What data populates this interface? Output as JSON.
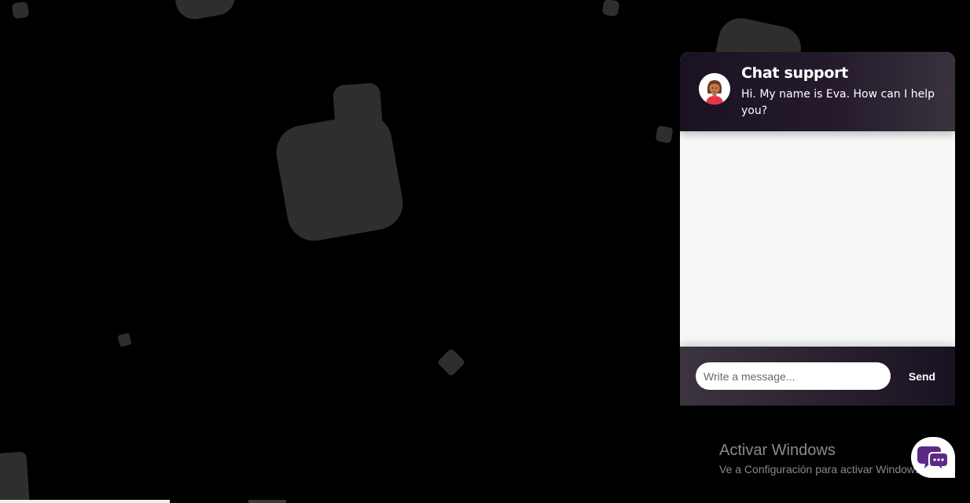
{
  "chat": {
    "title": "Chat support",
    "greeting": "Hi. My name is Eva. How can I help you?",
    "avatar_icon": "female-support-agent-avatar",
    "input_placeholder": "Write a message...",
    "input_value": "",
    "send_label": "Send",
    "launcher_icon": "chat-bubbles-icon"
  },
  "watermark": {
    "title": "Activar Windows",
    "subtitle": "Ve a Configuración para activar Windows."
  },
  "colors": {
    "background": "#000000",
    "floating_shape": "#2e2e2e",
    "header_dark": "#1a1222",
    "header_light": "#3a323d",
    "body": "#f8f8f8",
    "launcher_icon": "#5b2a86"
  }
}
